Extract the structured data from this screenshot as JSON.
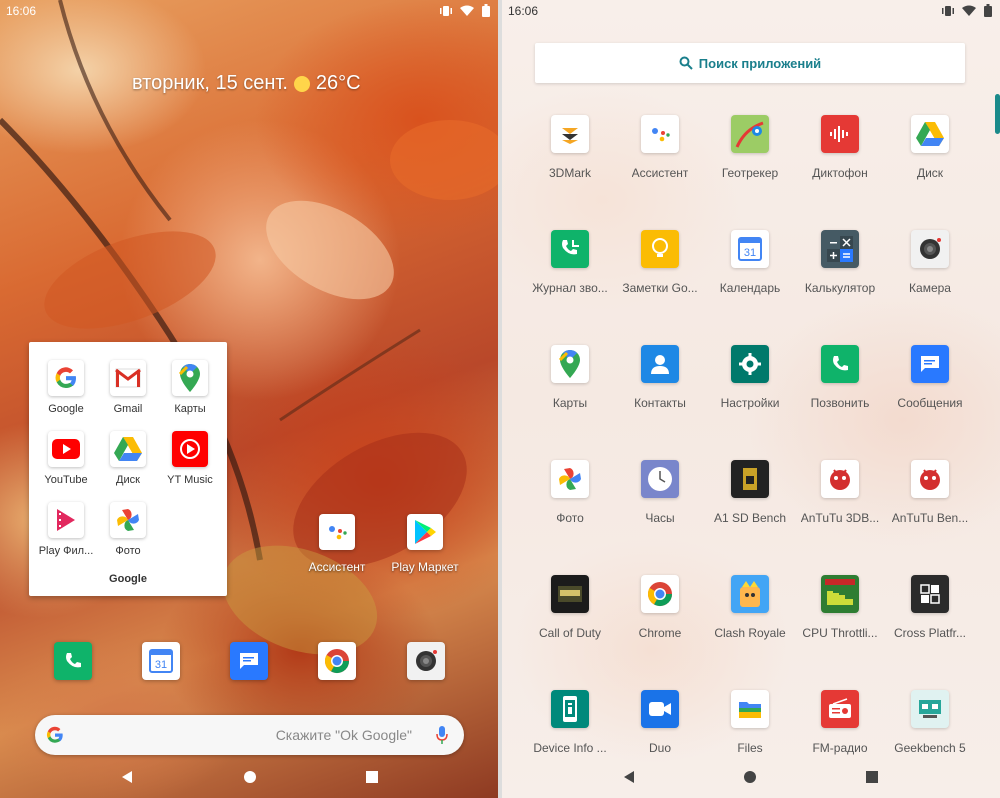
{
  "status_bar": {
    "time": "16:06"
  },
  "home": {
    "weather_date": "вторник, 15 сент.",
    "weather_temp": "26°C",
    "folder": {
      "title": "Google",
      "apps": [
        {
          "label": "Google",
          "icon": "google-icon"
        },
        {
          "label": "Gmail",
          "icon": "gmail-icon"
        },
        {
          "label": "Карты",
          "icon": "maps-icon"
        },
        {
          "label": "YouTube",
          "icon": "youtube-icon"
        },
        {
          "label": "Диск",
          "icon": "drive-icon"
        },
        {
          "label": "YT Music",
          "icon": "yt-music-icon"
        },
        {
          "label": "Play Фил...",
          "icon": "play-movies-icon"
        },
        {
          "label": "Фото",
          "icon": "photos-icon"
        }
      ]
    },
    "apps": [
      {
        "label": "Ассистент",
        "icon": "assistant-icon"
      },
      {
        "label": "Play Маркет",
        "icon": "play-store-icon"
      }
    ],
    "dock": [
      "phone-icon",
      "calendar-icon",
      "messages-icon",
      "chrome-icon",
      "camera-icon"
    ],
    "calendar_day": "31",
    "search_hint": "Скажите \"Ok Google\""
  },
  "drawer": {
    "search_placeholder": "Поиск приложений",
    "apps": [
      {
        "label": "3DMark",
        "icon": "3dmark-icon"
      },
      {
        "label": "Ассистент",
        "icon": "assistant-icon"
      },
      {
        "label": "Геотрекер",
        "icon": "geotracker-icon"
      },
      {
        "label": "Диктофон",
        "icon": "recorder-icon"
      },
      {
        "label": "Диск",
        "icon": "drive-icon"
      },
      {
        "label": "Журнал зво...",
        "icon": "call-log-icon"
      },
      {
        "label": "Заметки Go...",
        "icon": "keep-icon"
      },
      {
        "label": "Календарь",
        "icon": "calendar-icon"
      },
      {
        "label": "Калькулятор",
        "icon": "calculator-icon"
      },
      {
        "label": "Камера",
        "icon": "camera-icon"
      },
      {
        "label": "Карты",
        "icon": "maps-icon"
      },
      {
        "label": "Контакты",
        "icon": "contacts-icon"
      },
      {
        "label": "Настройки",
        "icon": "settings-icon"
      },
      {
        "label": "Позвонить",
        "icon": "phone-icon"
      },
      {
        "label": "Сообщения",
        "icon": "messages-icon"
      },
      {
        "label": "Фото",
        "icon": "photos-icon"
      },
      {
        "label": "Часы",
        "icon": "clock-icon"
      },
      {
        "label": "A1 SD Bench",
        "icon": "a1-sd-bench-icon"
      },
      {
        "label": "AnTuTu 3DB...",
        "icon": "antutu-3d-icon"
      },
      {
        "label": "AnTuTu Ben...",
        "icon": "antutu-icon"
      },
      {
        "label": "Call of Duty",
        "icon": "call-of-duty-icon"
      },
      {
        "label": "Chrome",
        "icon": "chrome-icon"
      },
      {
        "label": "Clash Royale",
        "icon": "clash-royale-icon"
      },
      {
        "label": "CPU Throttli...",
        "icon": "cpu-throttling-icon"
      },
      {
        "label": "Cross Platfr...",
        "icon": "cross-platform-icon"
      },
      {
        "label": "Device Info ...",
        "icon": "device-info-icon"
      },
      {
        "label": "Duo",
        "icon": "duo-icon"
      },
      {
        "label": "Files",
        "icon": "files-icon"
      },
      {
        "label": "FM-радио",
        "icon": "fm-radio-icon"
      },
      {
        "label": "Geekbench 5",
        "icon": "geekbench-icon"
      }
    ],
    "calendar_day": "31"
  },
  "colors": {
    "accent": "#1a7f8c",
    "drawer_bg": "#f6ebe5"
  }
}
